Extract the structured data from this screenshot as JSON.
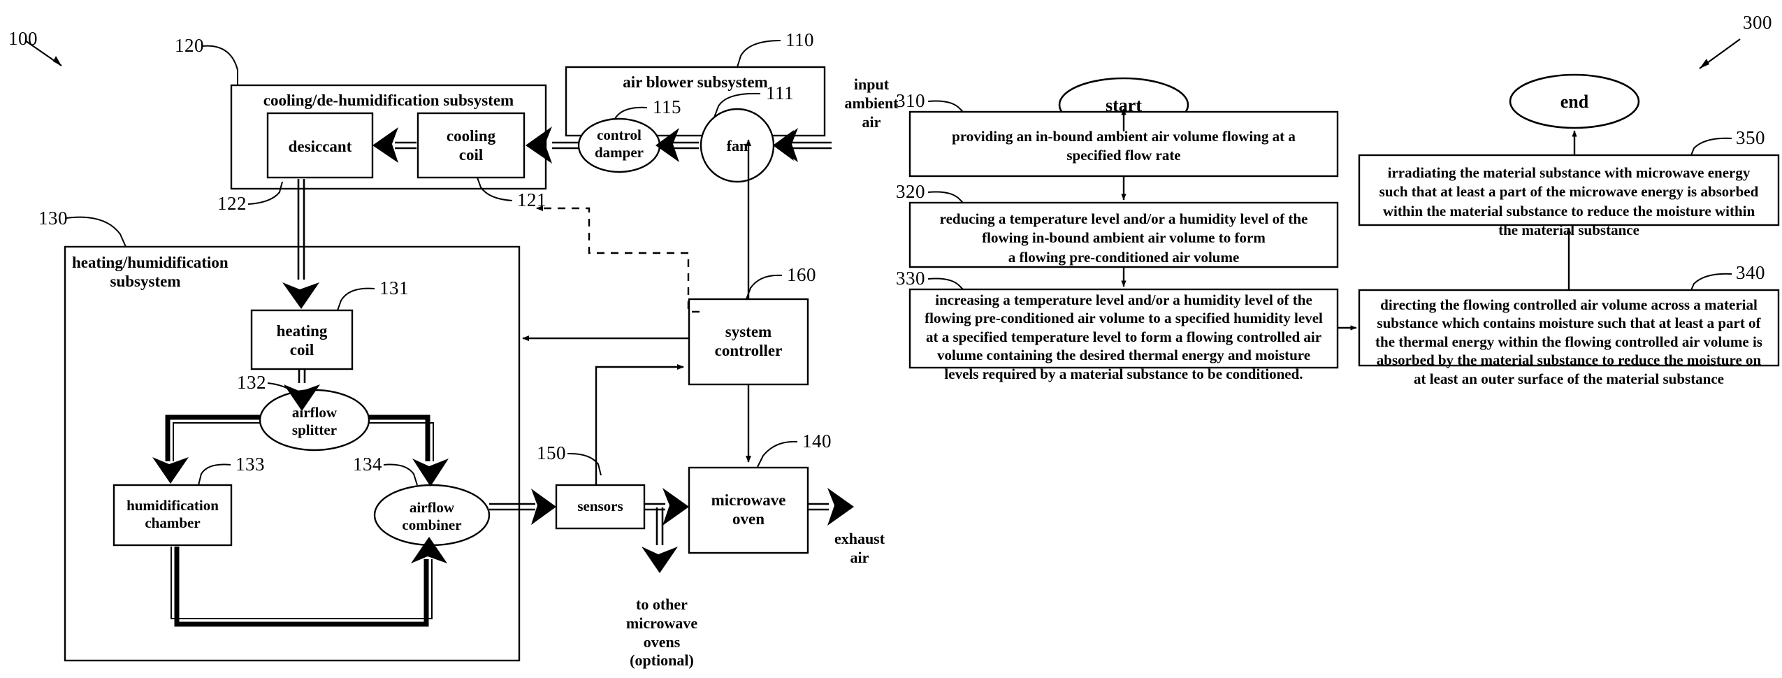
{
  "figure1": {
    "ref": "100",
    "subsystems": {
      "blower": {
        "ref": "110",
        "title": "air blower subsystem"
      },
      "cooling": {
        "ref": "120",
        "title": "cooling/de-humidification subsystem"
      },
      "heating": {
        "ref": "130",
        "title": "heating/humidification\nsubsystem"
      }
    },
    "nodes": {
      "fan": {
        "ref": "111",
        "label": "fan"
      },
      "control_damper": {
        "ref": "115",
        "label": "control\ndamper"
      },
      "cooling_coil": {
        "ref": "121",
        "label": "cooling\ncoil"
      },
      "desiccant": {
        "ref": "122",
        "label": "desiccant"
      },
      "heating_coil": {
        "ref": "131",
        "label": "heating\ncoil"
      },
      "airflow_splitter": {
        "ref": "132",
        "label": "airflow\nsplitter"
      },
      "humidification_chamber": {
        "ref": "133",
        "label": "humidification\nchamber"
      },
      "airflow_combiner": {
        "ref": "134",
        "label": "airflow\ncombiner"
      },
      "microwave_oven": {
        "ref": "140",
        "label": "microwave\noven"
      },
      "sensors": {
        "ref": "150",
        "label": "sensors"
      },
      "system_controller": {
        "ref": "160",
        "label": "system\ncontroller"
      }
    },
    "annotations": {
      "input_ambient_air": "input\nambient\nair",
      "exhaust_air": "exhaust\nair",
      "to_other_ovens": "to other\nmicrowave\novens\n(optional)"
    }
  },
  "figure3": {
    "ref": "300",
    "terminators": {
      "start": "start",
      "end": "end"
    },
    "steps": [
      {
        "ref": "310",
        "text": "providing an in-bound ambient air volume flowing at a specified flow rate"
      },
      {
        "ref": "320",
        "text": "reducing a temperature level and/or a humidity level of the flowing in-bound ambient air volume to form\na flowing pre-conditioned air volume"
      },
      {
        "ref": "330",
        "text": "increasing a temperature level and/or a humidity level of the flowing pre-conditioned air volume to a specified humidity level at a specified temperature level to form a flowing controlled air volume containing the desired thermal energy and moisture levels required by a material substance to be conditioned."
      },
      {
        "ref": "340",
        "text": "directing the flowing controlled air volume across a material substance which contains moisture such that at least a part of the thermal energy within the flowing controlled air volume is absorbed by the material substance to reduce the moisture on at least an outer surface of the material substance"
      },
      {
        "ref": "350",
        "text": "irradiating the material substance with microwave energy such that at least a part of the microwave energy is absorbed within the material substance to reduce the moisture within the material substance"
      }
    ]
  },
  "colors": {
    "ink": "#000000",
    "paper": "#ffffff"
  }
}
